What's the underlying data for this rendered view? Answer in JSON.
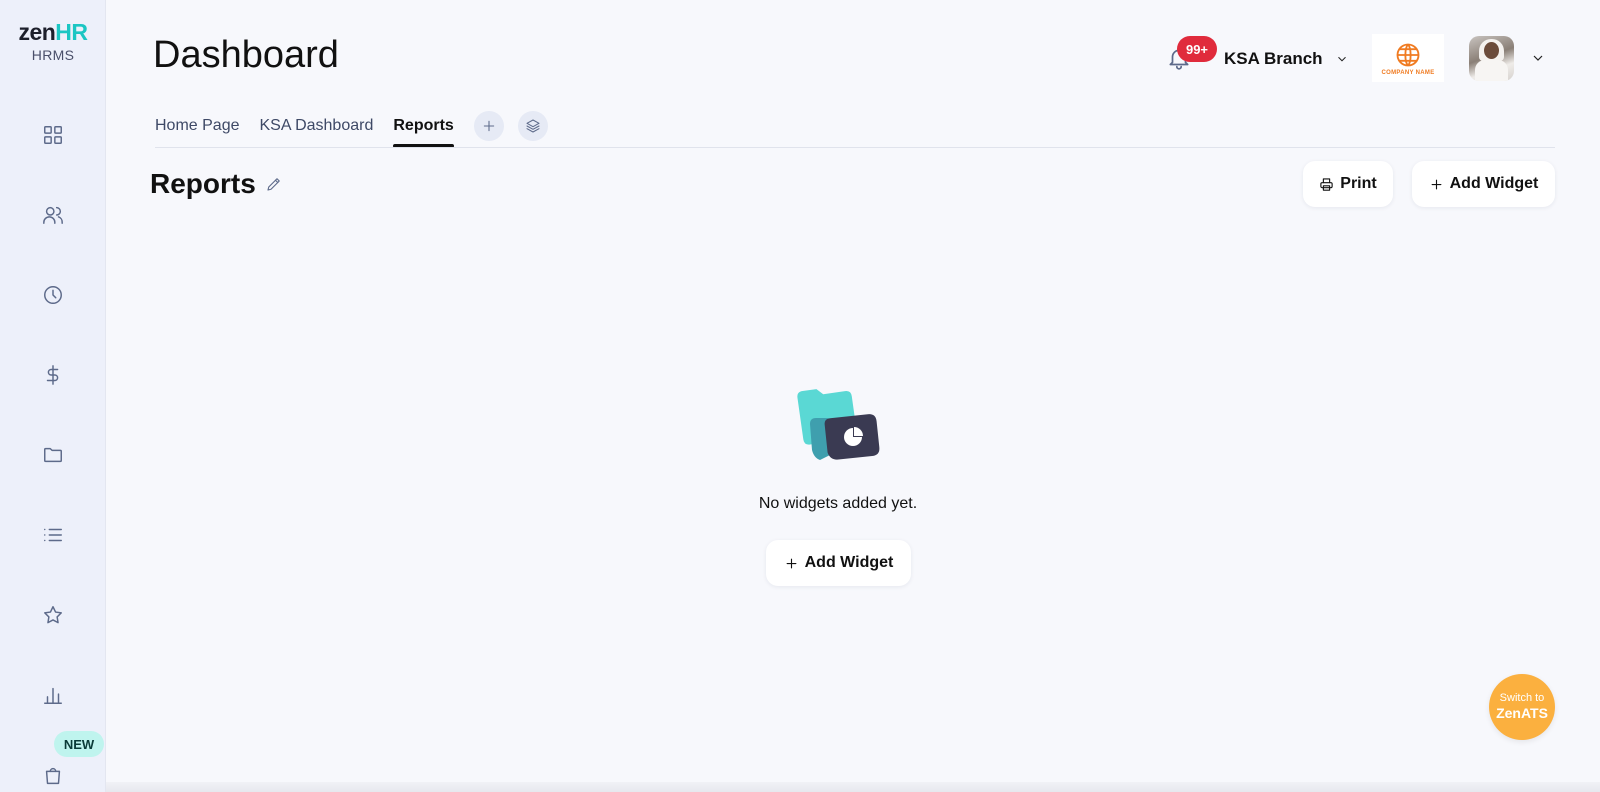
{
  "sidebar": {
    "logo_primary": "zen",
    "logo_accent": "HR",
    "logo_sub": "HRMS",
    "icons": [
      "grid-icon",
      "users-icon",
      "clock-icon",
      "dollar-icon",
      "folder-icon",
      "list-icon",
      "star-icon",
      "bar-chart-icon",
      "shopping-bag-icon"
    ],
    "new_badge": "NEW"
  },
  "header": {
    "title": "Dashboard",
    "notification_count": "99+",
    "branch": "KSA Branch",
    "company_logo_text": "COMPANY NAME"
  },
  "tabs": [
    {
      "label": "Home Page",
      "active": false
    },
    {
      "label": "KSA Dashboard",
      "active": false
    },
    {
      "label": "Reports",
      "active": true
    }
  ],
  "section": {
    "title": "Reports",
    "print_label": "Print",
    "add_widget_label": "Add Widget"
  },
  "empty_state": {
    "message": "No widgets added yet.",
    "add_widget_label": "Add Widget"
  },
  "switch": {
    "small": "Switch to",
    "big": "ZenATS"
  },
  "colors": {
    "brand_teal": "#1bc6c3",
    "notification_red": "#e02b3c",
    "switch_orange": "#fbb03f",
    "sidebar_bg": "#edf0fa"
  }
}
